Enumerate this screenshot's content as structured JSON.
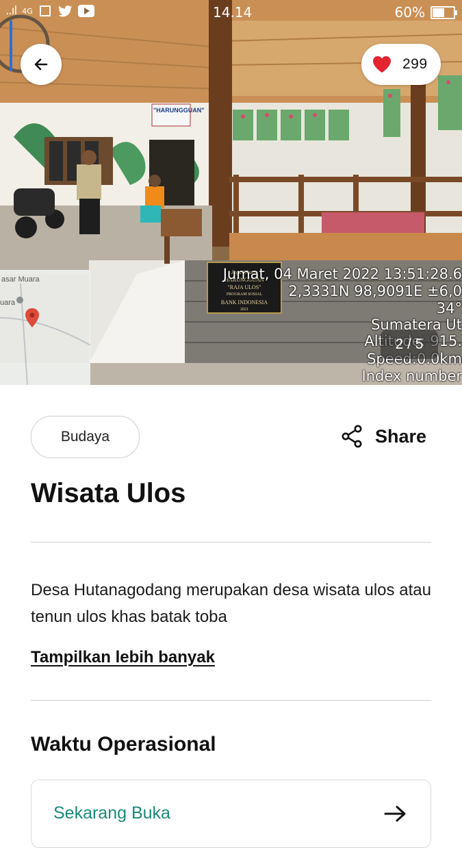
{
  "status_bar": {
    "signal": "..ıl",
    "network": "4G",
    "time": "14.14",
    "battery": "60%",
    "battery_level": 0.6
  },
  "hero": {
    "likes": "299",
    "pager": "2 / 5",
    "photo_overlay": {
      "date_line": "Jumat, 04 Maret 2022 13:51:28.6",
      "coords_line": "2,3331N 98,9091E ±6,0",
      "temp_line": "34°",
      "region_line": "Sumatera Ut",
      "altitude_line": "Altitude: 915.",
      "speed_line": "Speed:0.0km",
      "index_line": "Index number"
    },
    "minimap": {
      "label_top": "asar Muara",
      "label_left": "uara"
    },
    "plaque": {
      "line1": "Jaga Wisata",
      "line2": "HARUNGGUAN",
      "line3": "\"RAJA ULOS\"",
      "line4": "PROGRAM SOSIAL",
      "line5": "BANK INDONESIA",
      "line6": "2021"
    },
    "sign_text": "\"HARUNGGUAN\""
  },
  "category": "Budaya",
  "share_label": "Share",
  "title": "Wisata Ulos",
  "description": "Desa Hutanagodang merupakan desa wisata ulos atau tenun ulos khas batak toba",
  "show_more": "Tampilkan lebih banyak",
  "hours_section": {
    "title": "Waktu Operasional",
    "status": "Sekarang Buka",
    "status_color": "#1a8a78"
  },
  "colors": {
    "heart": "#e2252f",
    "divider": "#cfcfcf"
  }
}
